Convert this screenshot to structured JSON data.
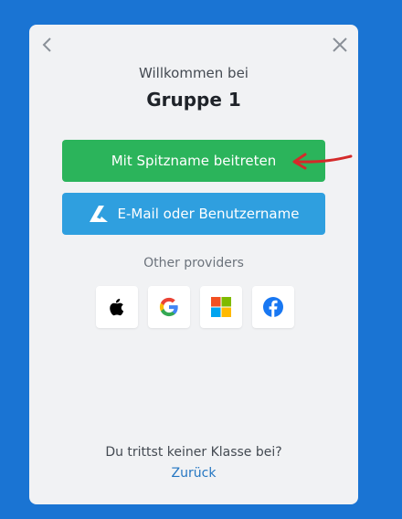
{
  "dialog": {
    "welcome_text": "Willkommen bei",
    "group_name": "Gruppe 1",
    "nickname_button_label": "Mit Spitzname beitreten",
    "email_button_label": "E-Mail oder Benutzername",
    "other_providers_label": "Other providers",
    "no_class_text": "Du trittst keiner Klasse bei?",
    "back_link_label": "Zurück"
  },
  "providers": [
    {
      "icon": "apple-icon"
    },
    {
      "icon": "google-icon"
    },
    {
      "icon": "microsoft-icon"
    },
    {
      "icon": "facebook-icon"
    }
  ],
  "colors": {
    "background": "#1a74d3",
    "panel": "#f1f2f4",
    "nickname_button": "#2bb45b",
    "email_button": "#2f9fdf",
    "link": "#2476c2",
    "annotation_arrow": "#d42a2a"
  }
}
